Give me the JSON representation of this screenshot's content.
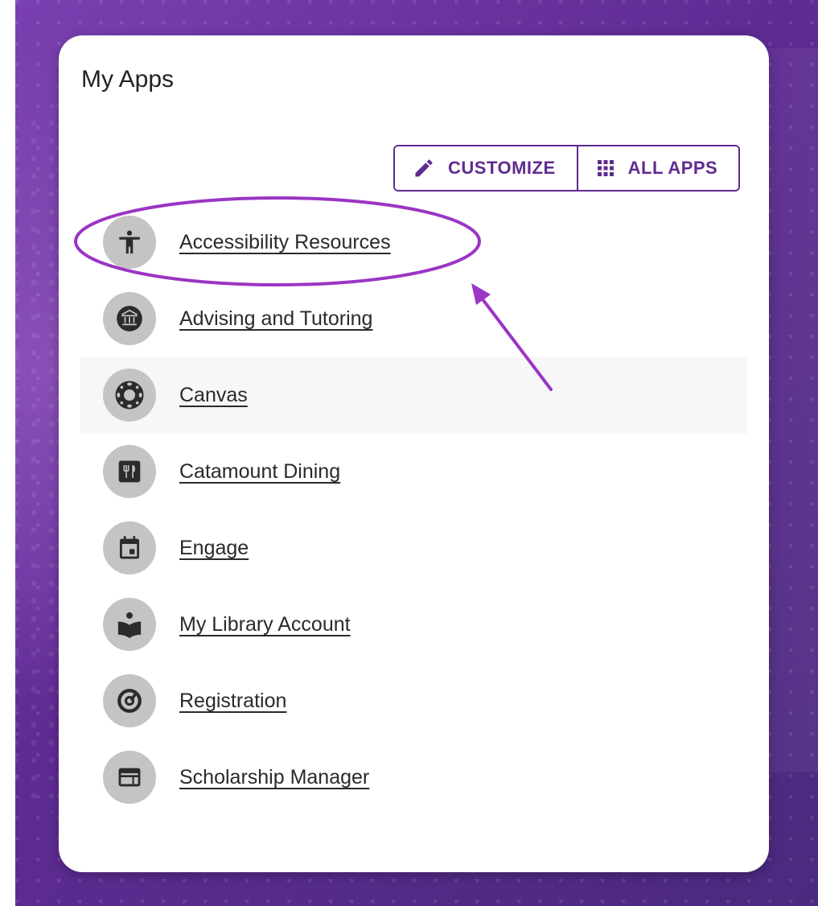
{
  "card": {
    "title": "My Apps"
  },
  "toolbar": {
    "customize_label": "CUSTOMIZE",
    "customize_icon": "pencil-icon",
    "all_apps_label": "ALL APPS",
    "all_apps_icon": "grid-icon"
  },
  "apps": [
    {
      "label": "Accessibility Resources",
      "icon": "accessibility-icon",
      "highlighted": true
    },
    {
      "label": "Advising and Tutoring",
      "icon": "institution-icon"
    },
    {
      "label": "Canvas",
      "icon": "canvas-icon",
      "hovered": true
    },
    {
      "label": "Catamount Dining",
      "icon": "dining-icon"
    },
    {
      "label": "Engage",
      "icon": "calendar-icon"
    },
    {
      "label": "My Library Account",
      "icon": "reader-icon"
    },
    {
      "label": "Registration",
      "icon": "registration-icon"
    },
    {
      "label": "Scholarship Manager",
      "icon": "window-icon"
    }
  ],
  "colors": {
    "accent": "#5f2b8f",
    "annotation": "#9b35c4",
    "icon_bg": "#c4c4c4",
    "icon_fg": "#2b2b2b"
  }
}
